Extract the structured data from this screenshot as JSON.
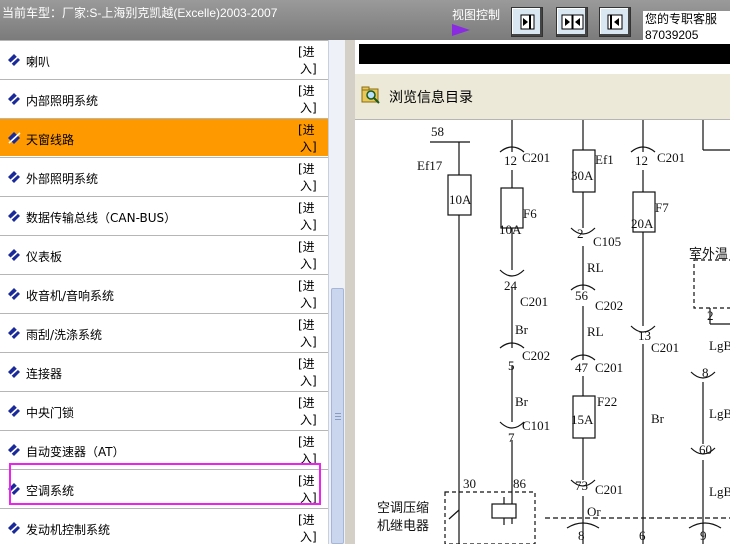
{
  "window": {
    "title": "当前车型：厂家:S-上海别克凯越(Excelle)2003-2007",
    "view_control_label": "视图控制",
    "view_buttons": [
      "arrow-right-into-bar-icon",
      "arrows-inward-icon",
      "arrow-left-from-bar-icon"
    ],
    "service_lines": [
      "您的专职客服",
      "87039205"
    ]
  },
  "sidebar": {
    "enter_line1": "[进",
    "enter_line2": "入]",
    "selected_index": 2,
    "items": [
      {
        "label": "喇叭"
      },
      {
        "label": "内部照明系统"
      },
      {
        "label": "天窗线路"
      },
      {
        "label": "外部照明系统"
      },
      {
        "label": "数据传输总线（CAN-BUS）"
      },
      {
        "label": "仪表板"
      },
      {
        "label": "收音机/音响系统"
      },
      {
        "label": "雨刮/洗涤系统"
      },
      {
        "label": "连接器"
      },
      {
        "label": "中央门锁"
      },
      {
        "label": "自动变速器（AT）"
      },
      {
        "label": "空调系统"
      },
      {
        "label": "发动机控制系统"
      }
    ]
  },
  "content": {
    "browse_title": "浏览信息目录",
    "diagram_labels": {
      "n58": "58",
      "ef17": "Ef17",
      "ef17_amp": "10A",
      "c201a": "C201",
      "pin12a": "12",
      "f6": "F6",
      "f6_amp": "10A",
      "pin24": "24",
      "c201b": "C201",
      "br1": "Br",
      "pin5": "5",
      "c202a": "C202",
      "br2": "Br",
      "pin7": "7",
      "c101": "C101",
      "n30": "30",
      "n86": "86",
      "relay1": "空调压缩",
      "relay2": "机继电器",
      "ef1": "Ef1",
      "ef1_amp": "30A",
      "pin2": "2",
      "c105": "C105",
      "rl1": "RL",
      "pin56": "56",
      "c202b": "C202",
      "rl2": "RL",
      "pin47": "47",
      "c201c": "C201",
      "f22": "F22",
      "f22_amp": "15A",
      "pin73": "73",
      "c201d": "C201",
      "or": "Or",
      "bottom8a": "8",
      "c201e": "C201",
      "pin12b": "12",
      "f7": "F7",
      "f7_amp": "20A",
      "pin13": "13",
      "c201f": "C201",
      "br3": "Br",
      "bottom6": "6",
      "outside": "室外温",
      "pin2b": "2",
      "lgb1": "LgB",
      "pin8": "8",
      "lgb2": "LgB",
      "pin60": "60",
      "lgb3": "LgB",
      "bottom9": "9"
    }
  }
}
